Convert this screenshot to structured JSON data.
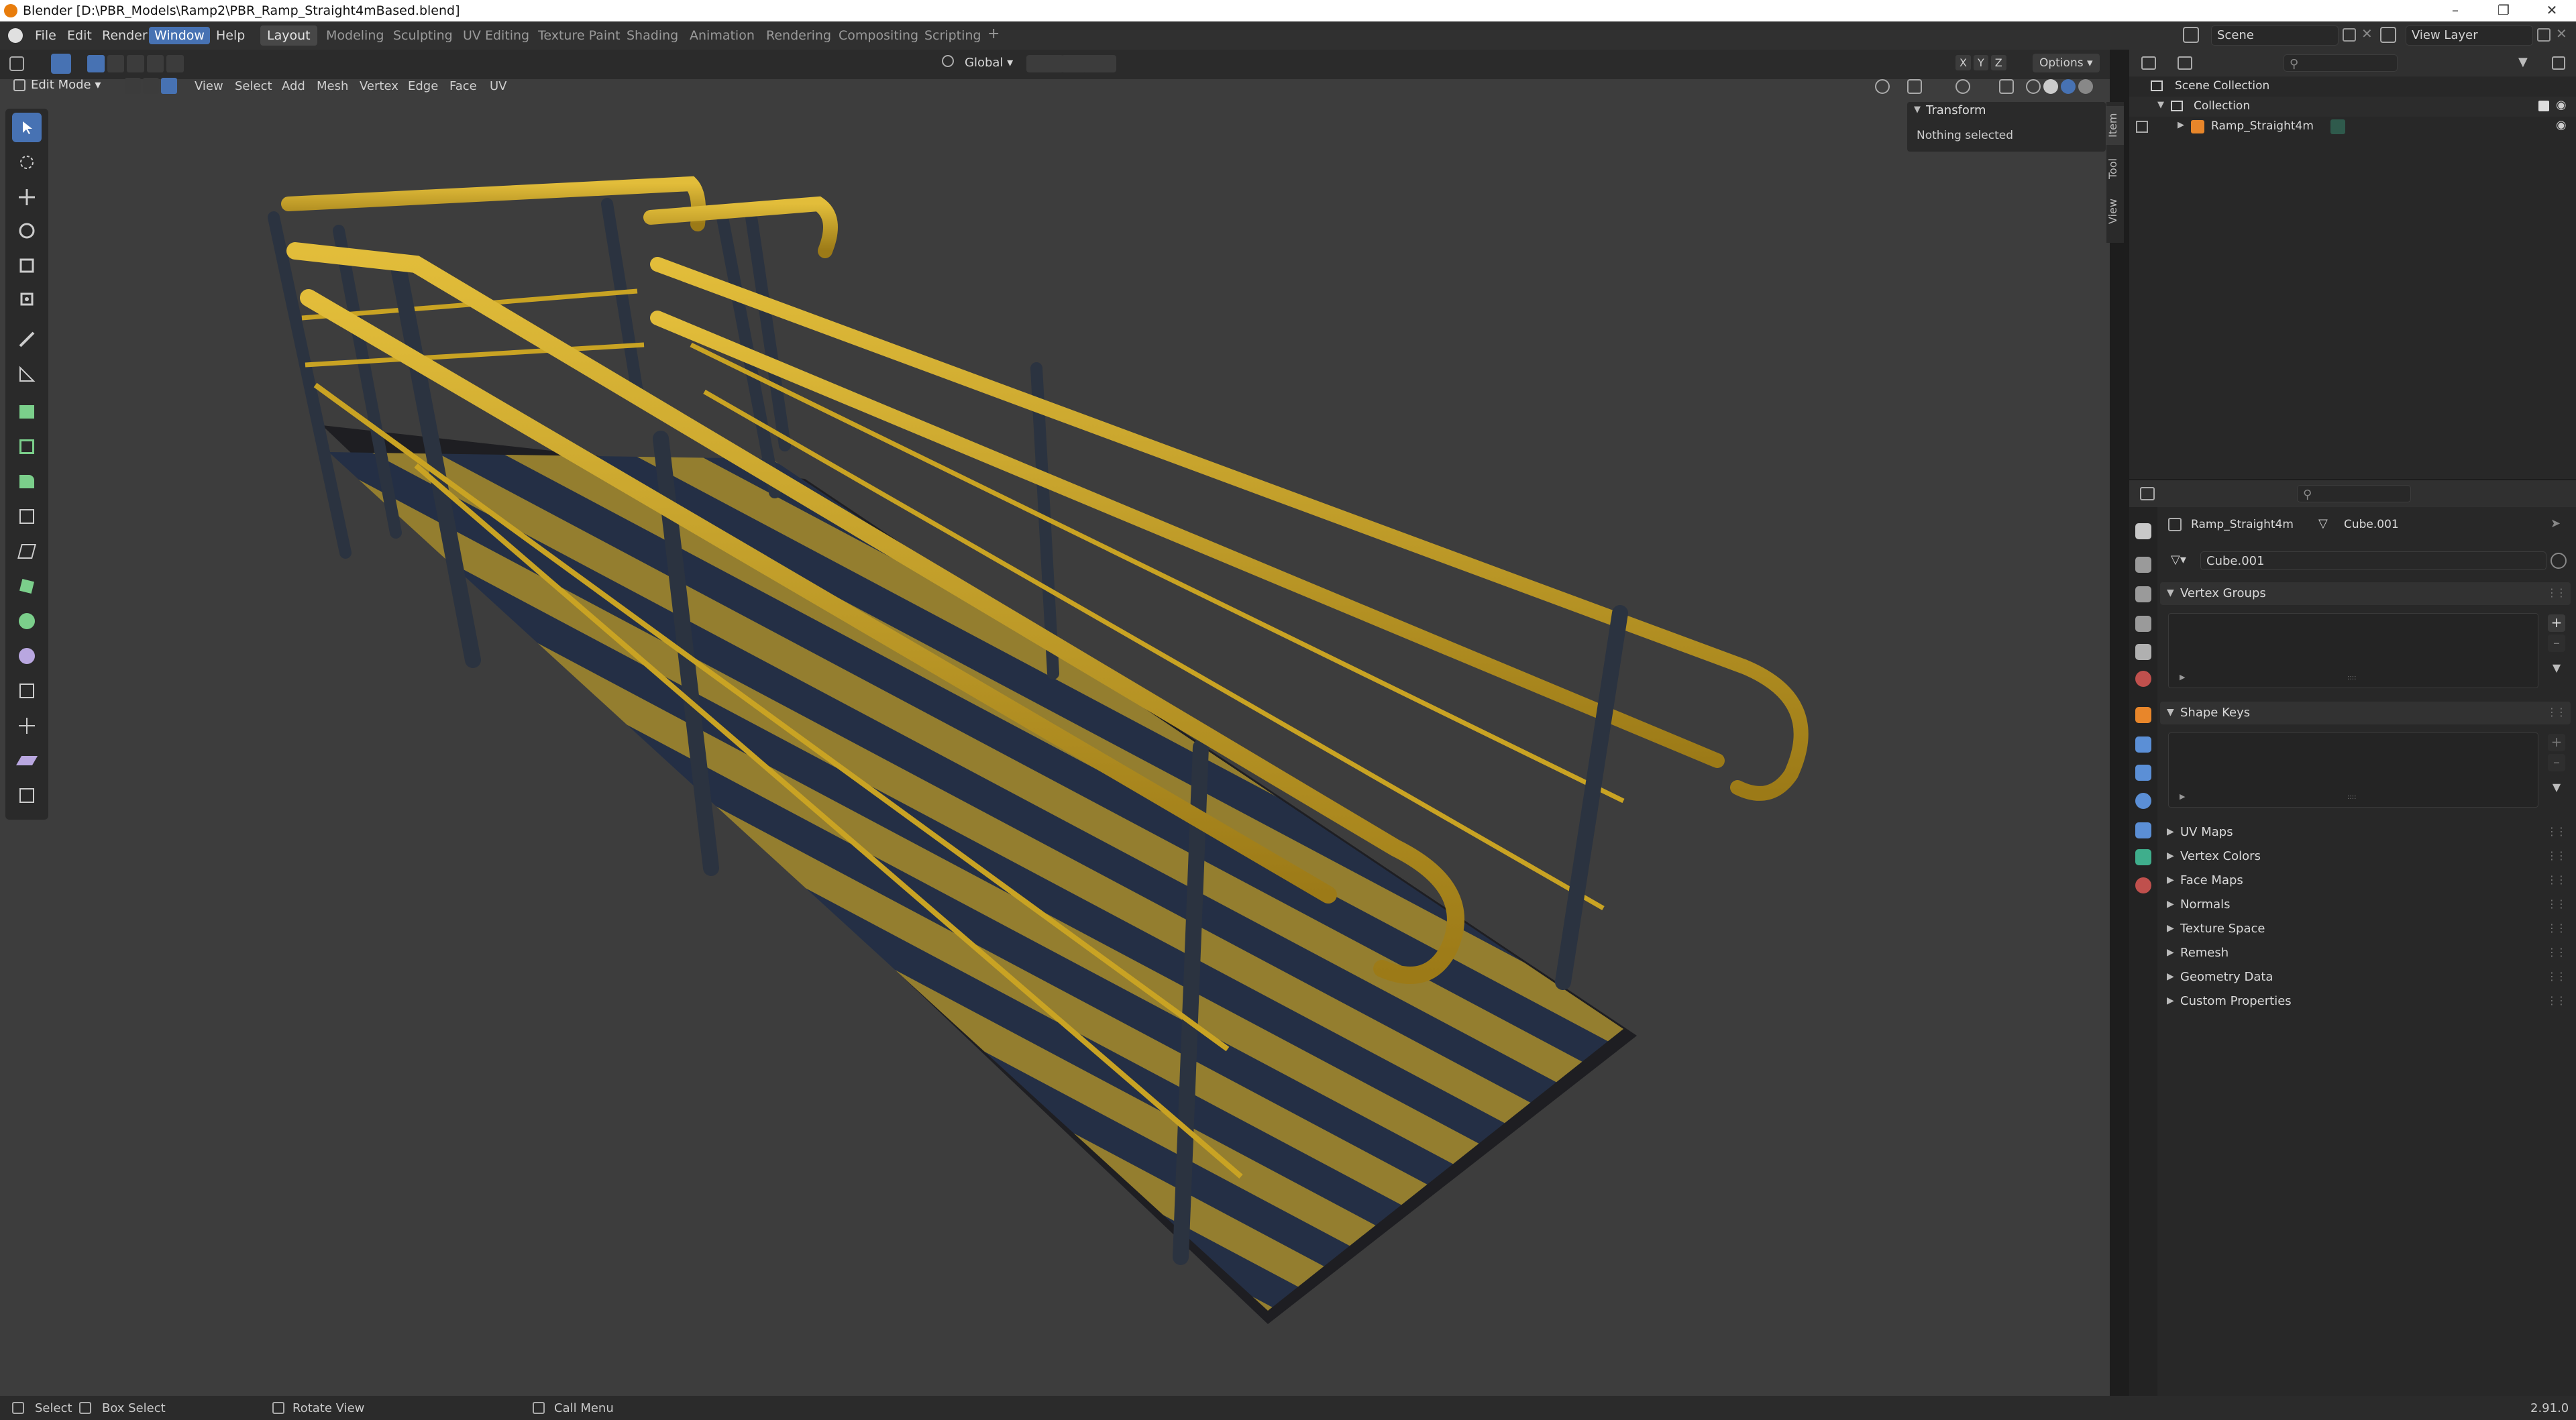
{
  "window": {
    "title": "Blender [D:\\PBR_Models\\Ramp2\\PBR_Ramp_Straight4mBased.blend]"
  },
  "menu": {
    "items": [
      "File",
      "Edit",
      "Render",
      "Window",
      "Help"
    ],
    "active": "Window"
  },
  "workspaces": {
    "tabs": [
      "Layout",
      "Modeling",
      "Sculpting",
      "UV Editing",
      "Texture Paint",
      "Shading",
      "Animation",
      "Rendering",
      "Compositing",
      "Scripting"
    ],
    "active": "Layout",
    "add_symbol": "+"
  },
  "scene": {
    "scene_name": "Scene",
    "view_layer": "View Layer"
  },
  "tool_header": {
    "orientation": "Global",
    "axes": [
      "X",
      "Y",
      "Z"
    ],
    "options_label": "Options"
  },
  "view_header": {
    "mode": "Edit Mode",
    "menus": [
      "View",
      "Select",
      "Add",
      "Mesh",
      "Vertex",
      "Edge",
      "Face",
      "UV"
    ]
  },
  "npanel": {
    "section": "Transform",
    "message": "Nothing selected",
    "tabs": [
      "Item",
      "Tool",
      "View"
    ]
  },
  "outliner": {
    "root": "Scene Collection",
    "collection": "Collection",
    "object": "Ramp_Straight4m"
  },
  "properties": {
    "object_name": "Ramp_Straight4m",
    "mesh_name": "Cube.001",
    "datablock": "Cube.001",
    "open_sections": [
      "Vertex Groups",
      "Shape Keys"
    ],
    "collapsed_sections": [
      "UV Maps",
      "Vertex Colors",
      "Face Maps",
      "Normals",
      "Texture Space",
      "Remesh",
      "Geometry Data",
      "Custom Properties"
    ]
  },
  "statusbar": {
    "items": [
      "Select",
      "Box Select",
      "Rotate View",
      "Call Menu"
    ],
    "version": "2.91.0"
  },
  "colors": {
    "accent": "#4772b3",
    "viewport_bg": "#3d3d3d",
    "rail_yellow": "#c9a323",
    "post_metal": "#2b3340",
    "stripe_yellow": "#b59a3a",
    "plate_blue": "#2c3a55",
    "mesh_icon": "#3fae8c",
    "object_icon": "#e8862a"
  }
}
